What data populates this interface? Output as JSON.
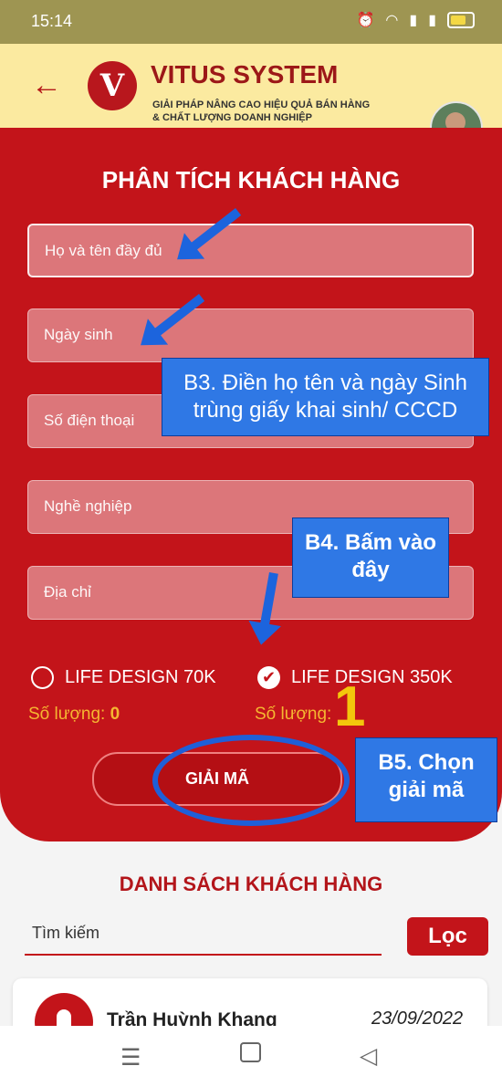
{
  "status": {
    "time": "15:14",
    "icons": [
      "alarm-icon",
      "wifi-icon",
      "signal-icon",
      "signal-icon",
      "battery-icon"
    ]
  },
  "header": {
    "logo_letter": "V",
    "brand": "VITUS SYSTEM",
    "tagline_line1": "GIẢI PHÁP NÂNG CAO HIỆU QUẢ BÁN HÀNG",
    "tagline_line2": "& CHẤT LƯỢNG DOANH NGHIỆP"
  },
  "form": {
    "title": "PHÂN TÍCH KHÁCH HÀNG",
    "full_name_placeholder": "Họ và tên đầy đủ",
    "birthdate_placeholder": "Ngày sinh",
    "phone_placeholder": "Số điện thoại",
    "job_placeholder": "Nghề nghiệp",
    "address_placeholder": "Địa chỉ"
  },
  "packages": [
    {
      "label": "LIFE DESIGN 70K",
      "selected": false,
      "quantity_label": "Số lượng:",
      "quantity": "0"
    },
    {
      "label": "LIFE DESIGN 350K",
      "selected": true,
      "quantity_label": "Số lượng:",
      "quantity": "1"
    }
  ],
  "actions": {
    "decode_label": "GIẢI MÃ"
  },
  "annotations": {
    "step3": "B3. Điền họ tên và ngày Sinh trùng giấy khai sinh/ CCCD",
    "step4": "B4. Bấm vào đây",
    "step5": "B5. Chọn giải mã"
  },
  "customer_list": {
    "title": "DANH SÁCH KHÁCH HÀNG",
    "search_placeholder": "Tìm kiếm",
    "filter_label": "Lọc",
    "items": [
      {
        "name": "Trần Huỳnh Khang",
        "date": "23/09/2022"
      }
    ]
  },
  "colors": {
    "accent": "#c3141a",
    "header": "#fbeaa0",
    "annotation": "#2f78e5",
    "highlight": "#f3c70c"
  }
}
